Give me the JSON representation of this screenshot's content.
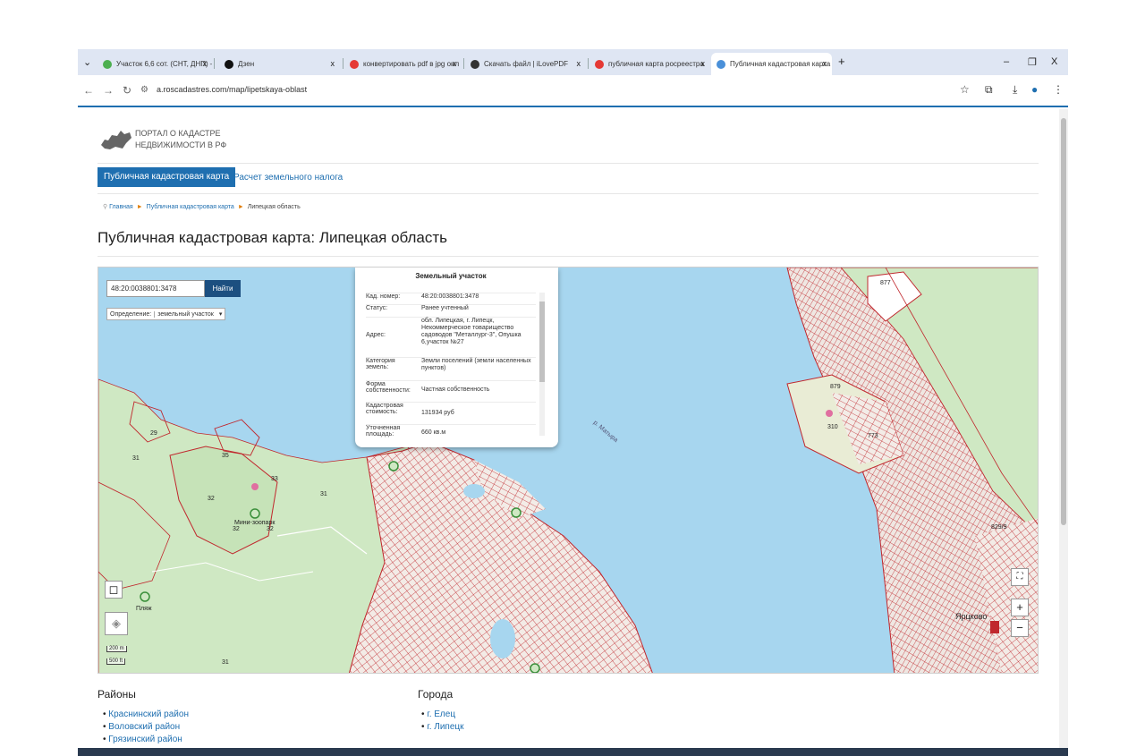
{
  "browser": {
    "tabs": [
      {
        "title": "Участок 6,6 сот. (СНТ, ДНП) – ...",
        "icon_color": "#4caf50"
      },
      {
        "title": "Дзен",
        "icon_color": "#111111"
      },
      {
        "title": "конвертировать pdf в jpg онл",
        "icon_color": "#e53935"
      },
      {
        "title": "Скачать файл | iLovePDF",
        "icon_color": "#333333"
      },
      {
        "title": "публичная карта росреестра",
        "icon_color": "#e53935"
      },
      {
        "title": "Публичная кадастровая карта",
        "icon_color": "#4a90d9"
      }
    ],
    "close_glyph": "x",
    "new_tab": "+",
    "url": "a.roscadastres.com/map/lipetskaya-oblast",
    "window_buttons": [
      "–",
      "❐",
      "X"
    ]
  },
  "site": {
    "logo_line1": "ПОРТАЛ О КАДАСТРЕ",
    "logo_line2": "НЕДВИЖИМОСТИ В РФ",
    "menu": [
      "Публичная кадастровая карта",
      "Расчет земельного налога"
    ],
    "breadcrumb": [
      "Главная",
      "Публичная кадастровая карта",
      "Липецкая область"
    ],
    "page_title": "Публичная кадастровая карта: Липецкая область"
  },
  "map": {
    "search_value": "48:20:0038801:3478",
    "search_button": "Найти",
    "definition_label": "Определение:",
    "definition_value": "земельный участок",
    "popup": {
      "title": "Земельный участок",
      "rows": [
        {
          "k": "Кад. номер:",
          "v": "48:20:0038801:3478"
        },
        {
          "k": "Статус:",
          "v": "Ранее учтенный"
        },
        {
          "k": "Адрес:",
          "v": "обл. Липецкая, г. Липецк, Некоммерческое товарищество садоводов \"Металлург-3\", Опушка 6,участок №27"
        },
        {
          "k": "Категория земель:",
          "v": "Земли поселений (земли населенных пунктов)"
        },
        {
          "k": "Форма собственности:",
          "v": "Частная собственность"
        },
        {
          "k": "Кадастровая стоимость:",
          "v": "131934 руб"
        },
        {
          "k": "Уточненная площадь:",
          "v": "660 кв.м"
        }
      ]
    },
    "labels": {
      "l31a": "31",
      "l29": "29",
      "l35": "35",
      "l32a": "32",
      "l31b": "31",
      "l33": "33",
      "l31c": "31",
      "l32b": "32",
      "l32c": "32",
      "minizoo": "Мини-зоопарк",
      "plyazh": "Пляж",
      "l31d": "31",
      "l877": "877",
      "l879": "879",
      "l310": "310",
      "l773": "773",
      "l829": "829/9",
      "yarkovo": "Ярцково",
      "river": "р. Матыра"
    },
    "scale_1": "200 m",
    "scale_2": "500 ft",
    "zoom_in": "+",
    "zoom_out": "−",
    "colors": {
      "water": "#a7d6ef",
      "land": "#cfe8c3",
      "parcel": "#c0272d",
      "button": "#1c4f80",
      "accent": "#1f6fb0"
    }
  },
  "bottom": {
    "districts_title": "Районы",
    "districts": [
      "Краснинский район",
      "Воловский район",
      "Грязинский район"
    ],
    "cities_title": "Города",
    "cities": [
      "г. Елец",
      "г. Липецк"
    ]
  }
}
